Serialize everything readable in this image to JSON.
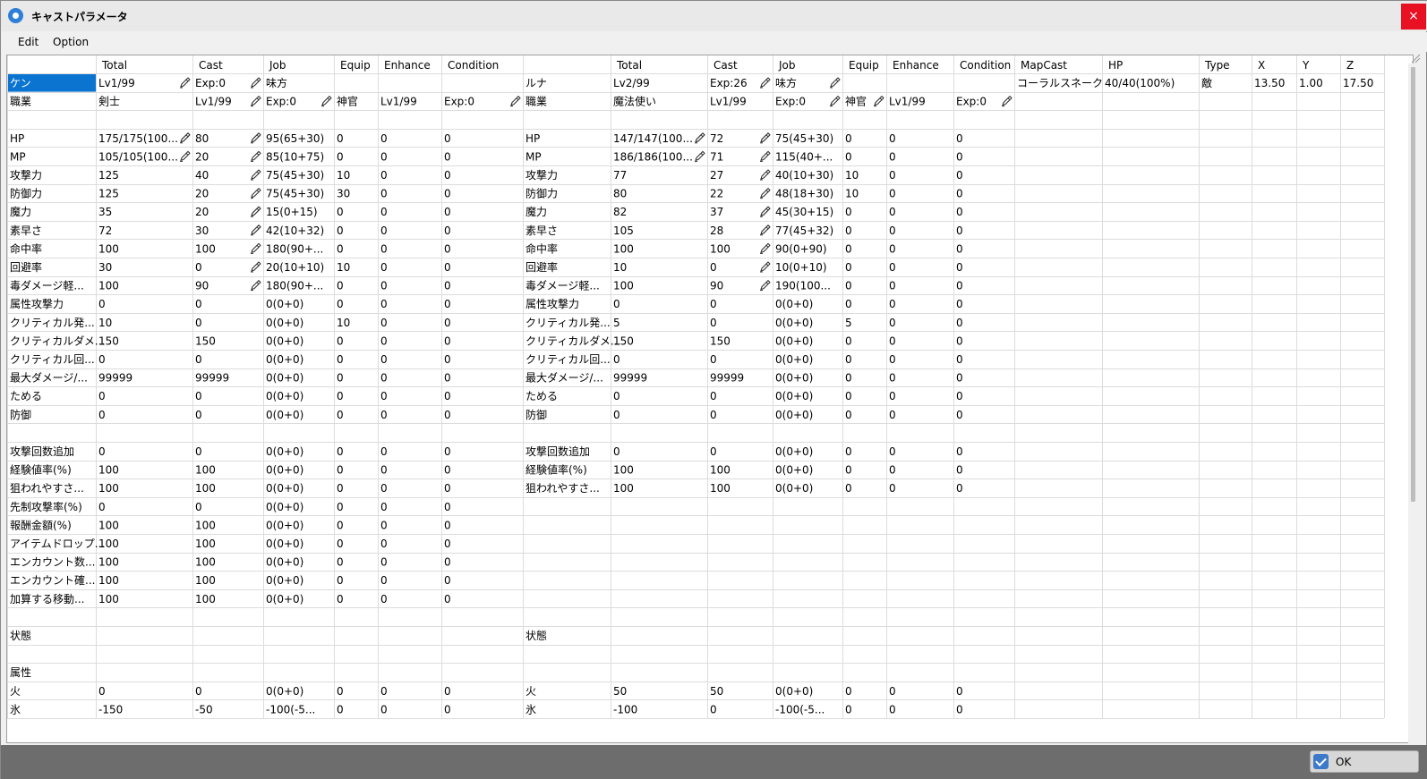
{
  "window": {
    "title": "キャストパラメータ",
    "close_label": "×"
  },
  "menu": [
    "Edit",
    "Option"
  ],
  "colors": {
    "selection": "#0a74d0",
    "grid_line": "#dcdcdc",
    "bottom_bar": "#6d6d6d",
    "ok_check": "#3c79c9"
  },
  "table": {
    "headers": [
      "",
      "Total",
      "Cast",
      "Job",
      "Equip",
      "Enhance",
      "Condition",
      "",
      "Total",
      "Cast",
      "Job",
      "Equip",
      "Enhance",
      "Condition",
      "MapCast",
      "HP",
      "Type",
      "X",
      "Y",
      "Z"
    ],
    "rows": [
      [
        "ケン",
        "Lv1/99",
        "Exp:0",
        "味方",
        "",
        "",
        "",
        "ルナ",
        "Lv2/99",
        "Exp:26",
        "味方",
        "",
        "",
        "",
        "コーラルスネーク",
        "40/40(100%)",
        "敵",
        "13.50",
        "1.00",
        "17.50"
      ],
      [
        "職業",
        "剣士",
        "Lv1/99",
        "Exp:0",
        "神官",
        "Lv1/99",
        "Exp:0",
        "職業",
        "魔法使い",
        "Lv1/99",
        "Exp:0",
        "神官",
        "Lv1/99",
        "Exp:0",
        "",
        "",
        "",
        "",
        "",
        ""
      ],
      [
        "",
        "",
        "",
        "",
        "",
        "",
        "",
        "",
        "",
        "",
        "",
        "",
        "",
        "",
        "",
        "",
        "",
        "",
        "",
        ""
      ],
      [
        "HP",
        "175/175(100...",
        "80",
        "95(65+30)",
        "0",
        "0",
        "0",
        "HP",
        "147/147(100...",
        "72",
        "75(45+30)",
        "0",
        "0",
        "0",
        "",
        "",
        "",
        "",
        "",
        ""
      ],
      [
        "MP",
        "105/105(100...",
        "20",
        "85(10+75)",
        "0",
        "0",
        "0",
        "MP",
        "186/186(100...",
        "71",
        "115(40+...",
        "0",
        "0",
        "0",
        "",
        "",
        "",
        "",
        "",
        ""
      ],
      [
        "攻撃力",
        "125",
        "40",
        "75(45+30)",
        "10",
        "0",
        "0",
        "攻撃力",
        "77",
        "27",
        "40(10+30)",
        "10",
        "0",
        "0",
        "",
        "",
        "",
        "",
        "",
        ""
      ],
      [
        "防御力",
        "125",
        "20",
        "75(45+30)",
        "30",
        "0",
        "0",
        "防御力",
        "80",
        "22",
        "48(18+30)",
        "10",
        "0",
        "0",
        "",
        "",
        "",
        "",
        "",
        ""
      ],
      [
        "魔力",
        "35",
        "20",
        "15(0+15)",
        "0",
        "0",
        "0",
        "魔力",
        "82",
        "37",
        "45(30+15)",
        "0",
        "0",
        "0",
        "",
        "",
        "",
        "",
        "",
        ""
      ],
      [
        "素早さ",
        "72",
        "30",
        "42(10+32)",
        "0",
        "0",
        "0",
        "素早さ",
        "105",
        "28",
        "77(45+32)",
        "0",
        "0",
        "0",
        "",
        "",
        "",
        "",
        "",
        ""
      ],
      [
        "命中率",
        "100",
        "100",
        "180(90+...",
        "0",
        "0",
        "0",
        "命中率",
        "100",
        "100",
        "90(0+90)",
        "0",
        "0",
        "0",
        "",
        "",
        "",
        "",
        "",
        ""
      ],
      [
        "回避率",
        "30",
        "0",
        "20(10+10)",
        "10",
        "0",
        "0",
        "回避率",
        "10",
        "0",
        "10(0+10)",
        "0",
        "0",
        "0",
        "",
        "",
        "",
        "",
        "",
        ""
      ],
      [
        "毒ダメージ軽...",
        "100",
        "90",
        "180(90+...",
        "0",
        "0",
        "0",
        "毒ダメージ軽...",
        "100",
        "90",
        "190(100...",
        "0",
        "0",
        "0",
        "",
        "",
        "",
        "",
        "",
        ""
      ],
      [
        "属性攻撃力",
        "0",
        "0",
        "0(0+0)",
        "0",
        "0",
        "0",
        "属性攻撃力",
        "0",
        "0",
        "0(0+0)",
        "0",
        "0",
        "0",
        "",
        "",
        "",
        "",
        "",
        ""
      ],
      [
        "クリティカル発...",
        "10",
        "0",
        "0(0+0)",
        "10",
        "0",
        "0",
        "クリティカル発...",
        "5",
        "0",
        "0(0+0)",
        "5",
        "0",
        "0",
        "",
        "",
        "",
        "",
        "",
        ""
      ],
      [
        "クリティカルダメ...",
        "150",
        "150",
        "0(0+0)",
        "0",
        "0",
        "0",
        "クリティカルダメ...",
        "150",
        "150",
        "0(0+0)",
        "0",
        "0",
        "0",
        "",
        "",
        "",
        "",
        "",
        ""
      ],
      [
        "クリティカル回...",
        "0",
        "0",
        "0(0+0)",
        "0",
        "0",
        "0",
        "クリティカル回...",
        "0",
        "0",
        "0(0+0)",
        "0",
        "0",
        "0",
        "",
        "",
        "",
        "",
        "",
        ""
      ],
      [
        "最大ダメージ/...",
        "99999",
        "99999",
        "0(0+0)",
        "0",
        "0",
        "0",
        "最大ダメージ/...",
        "99999",
        "99999",
        "0(0+0)",
        "0",
        "0",
        "0",
        "",
        "",
        "",
        "",
        "",
        ""
      ],
      [
        "ためる",
        "0",
        "0",
        "0(0+0)",
        "0",
        "0",
        "0",
        "ためる",
        "0",
        "0",
        "0(0+0)",
        "0",
        "0",
        "0",
        "",
        "",
        "",
        "",
        "",
        ""
      ],
      [
        "防御",
        "0",
        "0",
        "0(0+0)",
        "0",
        "0",
        "0",
        "防御",
        "0",
        "0",
        "0(0+0)",
        "0",
        "0",
        "0",
        "",
        "",
        "",
        "",
        "",
        ""
      ],
      [
        "",
        "",
        "",
        "",
        "",
        "",
        "",
        "",
        "",
        "",
        "",
        "",
        "",
        "",
        "",
        "",
        "",
        "",
        "",
        ""
      ],
      [
        "攻撃回数追加",
        "0",
        "0",
        "0(0+0)",
        "0",
        "0",
        "0",
        "攻撃回数追加",
        "0",
        "0",
        "0(0+0)",
        "0",
        "0",
        "0",
        "",
        "",
        "",
        "",
        "",
        ""
      ],
      [
        "経験値率(%)",
        "100",
        "100",
        "0(0+0)",
        "0",
        "0",
        "0",
        "経験値率(%)",
        "100",
        "100",
        "0(0+0)",
        "0",
        "0",
        "0",
        "",
        "",
        "",
        "",
        "",
        ""
      ],
      [
        "狙われやすさ...",
        "100",
        "100",
        "0(0+0)",
        "0",
        "0",
        "0",
        "狙われやすさ...",
        "100",
        "100",
        "0(0+0)",
        "0",
        "0",
        "0",
        "",
        "",
        "",
        "",
        "",
        ""
      ],
      [
        "先制攻撃率(%)",
        "0",
        "0",
        "0(0+0)",
        "0",
        "0",
        "0",
        "",
        "",
        "",
        "",
        "",
        "",
        "",
        "",
        "",
        "",
        "",
        "",
        ""
      ],
      [
        "報酬金額(%)",
        "100",
        "100",
        "0(0+0)",
        "0",
        "0",
        "0",
        "",
        "",
        "",
        "",
        "",
        "",
        "",
        "",
        "",
        "",
        "",
        "",
        ""
      ],
      [
        "アイテムドロップ...",
        "100",
        "100",
        "0(0+0)",
        "0",
        "0",
        "0",
        "",
        "",
        "",
        "",
        "",
        "",
        "",
        "",
        "",
        "",
        "",
        "",
        ""
      ],
      [
        "エンカウント数...",
        "100",
        "100",
        "0(0+0)",
        "0",
        "0",
        "0",
        "",
        "",
        "",
        "",
        "",
        "",
        "",
        "",
        "",
        "",
        "",
        "",
        ""
      ],
      [
        "エンカウント確...",
        "100",
        "100",
        "0(0+0)",
        "0",
        "0",
        "0",
        "",
        "",
        "",
        "",
        "",
        "",
        "",
        "",
        "",
        "",
        "",
        "",
        ""
      ],
      [
        "加算する移動...",
        "100",
        "100",
        "0(0+0)",
        "0",
        "0",
        "0",
        "",
        "",
        "",
        "",
        "",
        "",
        "",
        "",
        "",
        "",
        "",
        "",
        ""
      ],
      [
        "",
        "",
        "",
        "",
        "",
        "",
        "",
        "",
        "",
        "",
        "",
        "",
        "",
        "",
        "",
        "",
        "",
        "",
        "",
        ""
      ],
      [
        "状態",
        "",
        "",
        "",
        "",
        "",
        "",
        "状態",
        "",
        "",
        "",
        "",
        "",
        "",
        "",
        "",
        "",
        "",
        "",
        ""
      ],
      [
        "",
        "",
        "",
        "",
        "",
        "",
        "",
        "",
        "",
        "",
        "",
        "",
        "",
        "",
        "",
        "",
        "",
        "",
        "",
        ""
      ],
      [
        "属性",
        "",
        "",
        "",
        "",
        "",
        "",
        "",
        "",
        "",
        "",
        "",
        "",
        "",
        "",
        "",
        "",
        "",
        "",
        ""
      ],
      [
        "  火",
        "0",
        "0",
        "0(0+0)",
        "0",
        "0",
        "0",
        "  火",
        "50",
        "50",
        "0(0+0)",
        "0",
        "0",
        "0",
        "",
        "",
        "",
        "",
        "",
        ""
      ],
      [
        "  氷",
        "-150",
        "-50",
        "-100(-5...",
        "0",
        "0",
        "0",
        "  氷",
        "-100",
        "0",
        "-100(-5...",
        "0",
        "0",
        "0",
        "",
        "",
        "",
        "",
        "",
        ""
      ]
    ],
    "edit_icon": "pencil-icon"
  },
  "footer": {
    "ok_label": "OK",
    "ok_icon": "check-icon"
  }
}
